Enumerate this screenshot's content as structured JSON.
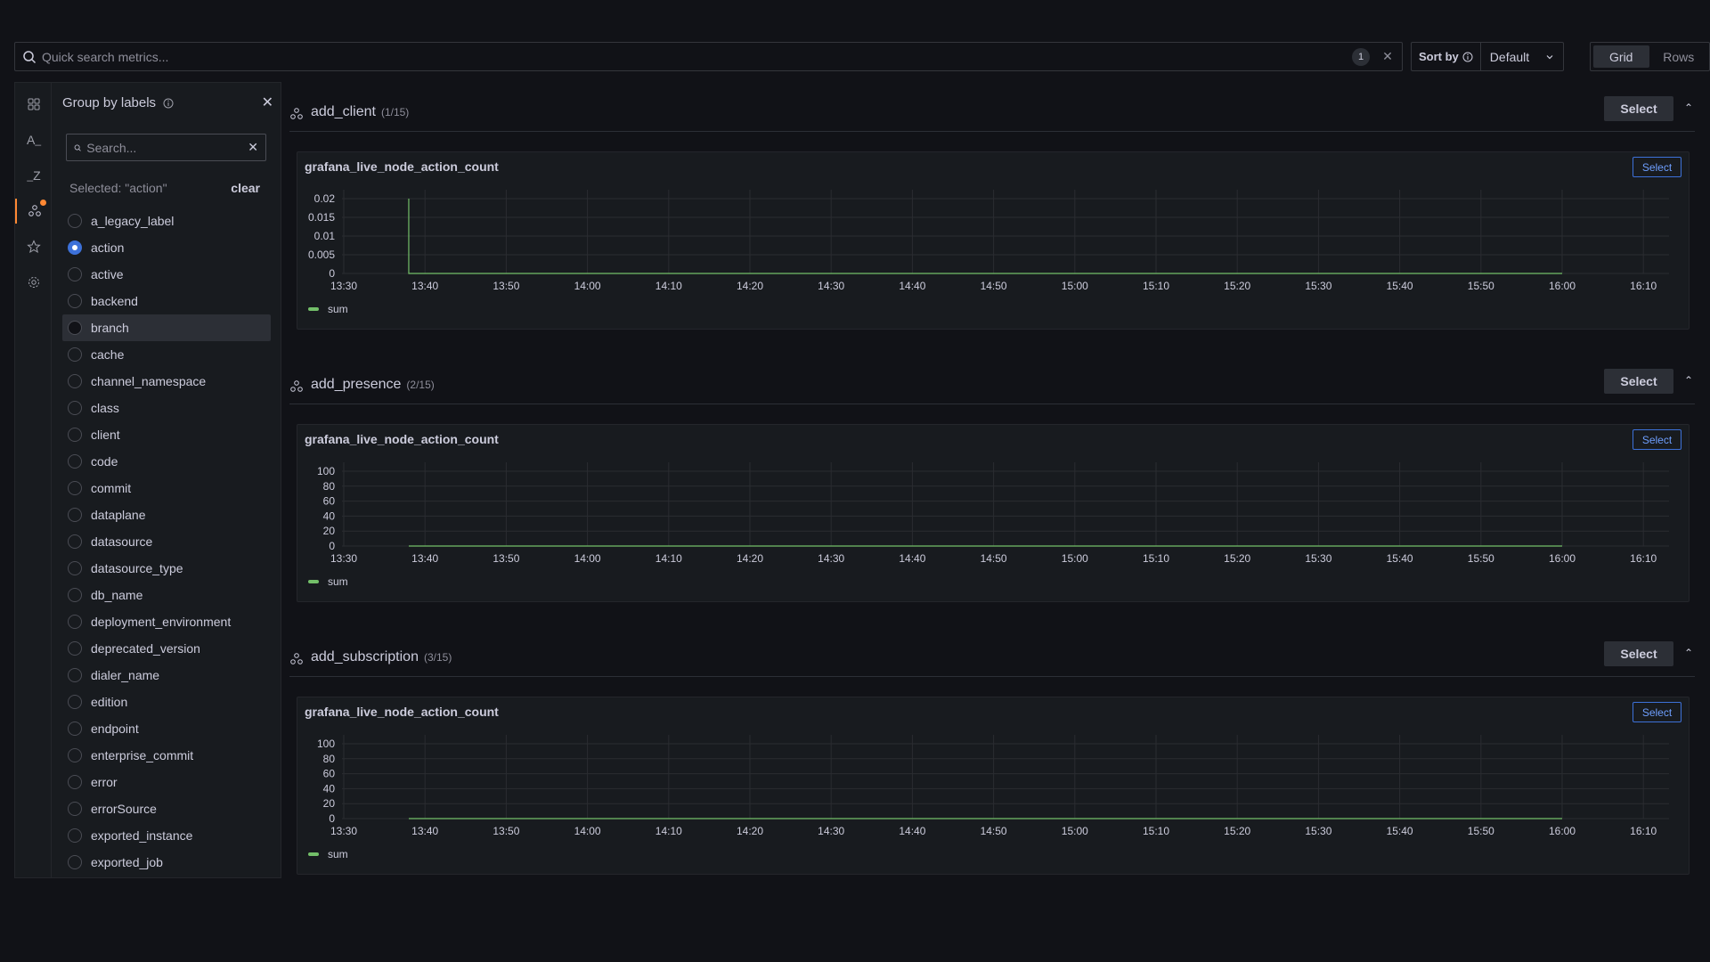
{
  "search": {
    "placeholder": "Quick search metrics...",
    "count": "1"
  },
  "sort": {
    "label": "Sort by",
    "value": "Default"
  },
  "view": {
    "grid": "Grid",
    "rows": "Rows"
  },
  "label_panel": {
    "title": "Group by labels",
    "search_placeholder": "Search...",
    "selected_text": "Selected: \"action\"",
    "clear": "clear",
    "items": [
      "a_legacy_label",
      "action",
      "active",
      "backend",
      "branch",
      "cache",
      "channel_namespace",
      "class",
      "client",
      "code",
      "commit",
      "dataplane",
      "datasource",
      "datasource_type",
      "db_name",
      "deployment_environment",
      "deprecated_version",
      "dialer_name",
      "edition",
      "endpoint",
      "enterprise_commit",
      "error",
      "errorSource",
      "exported_instance",
      "exported_job"
    ],
    "selected_item": "action",
    "hovered_item": "branch"
  },
  "sections": [
    {
      "name": "add_client",
      "fraction": "(1/15)",
      "select": "Select",
      "panel_title": "grafana_live_node_action_count",
      "panel_select": "Select"
    },
    {
      "name": "add_presence",
      "fraction": "(2/15)",
      "select": "Select",
      "panel_title": "grafana_live_node_action_count",
      "panel_select": "Select"
    },
    {
      "name": "add_subscription",
      "fraction": "(3/15)",
      "select": "Select",
      "panel_title": "grafana_live_node_action_count",
      "panel_select": "Select"
    }
  ],
  "colors": {
    "series": "#73bf69",
    "accent": "#3d71d9",
    "notify": "#ff8833"
  },
  "chart_data": [
    {
      "type": "line",
      "x": [
        "13:30",
        "13:40",
        "13:50",
        "14:00",
        "14:10",
        "14:20",
        "14:30",
        "14:40",
        "14:50",
        "15:00",
        "15:10",
        "15:20",
        "15:30",
        "15:40",
        "15:50",
        "16:00",
        "16:10"
      ],
      "y_ticks": [
        "0.02",
        "0.015",
        "0.01",
        "0.005",
        "0"
      ],
      "ylim": [
        0,
        0.02
      ],
      "series": [
        {
          "name": "sum",
          "points": [
            [
              "13:38",
              0.02
            ],
            [
              "13:38",
              0
            ],
            [
              "16:00",
              0
            ]
          ]
        }
      ]
    },
    {
      "type": "line",
      "x": [
        "13:30",
        "13:40",
        "13:50",
        "14:00",
        "14:10",
        "14:20",
        "14:30",
        "14:40",
        "14:50",
        "15:00",
        "15:10",
        "15:20",
        "15:30",
        "15:40",
        "15:50",
        "16:00",
        "16:10"
      ],
      "y_ticks": [
        "100",
        "80",
        "60",
        "40",
        "20",
        "0"
      ],
      "ylim": [
        0,
        100
      ],
      "series": [
        {
          "name": "sum",
          "points": [
            [
              "13:38",
              0
            ],
            [
              "16:00",
              0
            ]
          ]
        }
      ]
    },
    {
      "type": "line",
      "x": [
        "13:30",
        "13:40",
        "13:50",
        "14:00",
        "14:10",
        "14:20",
        "14:30",
        "14:40",
        "14:50",
        "15:00",
        "15:10",
        "15:20",
        "15:30",
        "15:40",
        "15:50",
        "16:00",
        "16:10"
      ],
      "y_ticks": [
        "100",
        "80",
        "60",
        "40",
        "20",
        "0"
      ],
      "ylim": [
        0,
        100
      ],
      "series": [
        {
          "name": "sum",
          "points": [
            [
              "13:38",
              0
            ],
            [
              "16:00",
              0
            ]
          ]
        }
      ]
    }
  ]
}
